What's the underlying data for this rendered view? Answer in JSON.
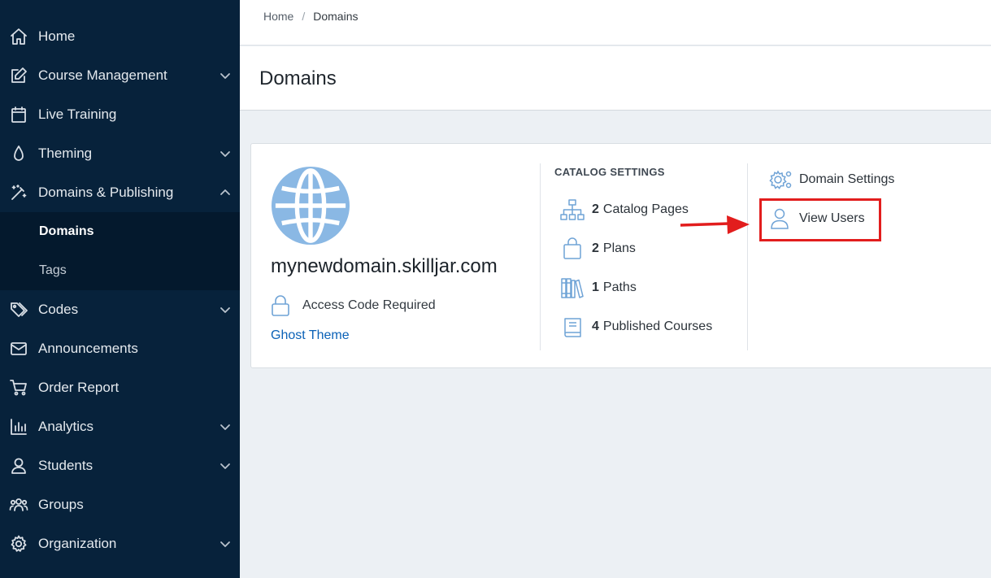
{
  "sidebar": {
    "items": [
      {
        "label": "Home",
        "icon": "home-icon",
        "chevron": false
      },
      {
        "label": "Course Management",
        "icon": "edit-icon",
        "chevron": "down"
      },
      {
        "label": "Live Training",
        "icon": "calendar-icon",
        "chevron": false
      },
      {
        "label": "Theming",
        "icon": "droplet-icon",
        "chevron": "down"
      },
      {
        "label": "Domains & Publishing",
        "icon": "magic-wand-icon",
        "chevron": "up"
      },
      {
        "label": "Codes",
        "icon": "tags-icon",
        "chevron": "down"
      },
      {
        "label": "Announcements",
        "icon": "envelope-icon",
        "chevron": false
      },
      {
        "label": "Order Report",
        "icon": "cart-icon",
        "chevron": false
      },
      {
        "label": "Analytics",
        "icon": "bar-chart-icon",
        "chevron": "down"
      },
      {
        "label": "Students",
        "icon": "user-icon",
        "chevron": "down"
      },
      {
        "label": "Groups",
        "icon": "users-icon",
        "chevron": false
      },
      {
        "label": "Organization",
        "icon": "gear-icon",
        "chevron": "down"
      }
    ],
    "submenu": [
      {
        "label": "Domains",
        "active": true
      },
      {
        "label": "Tags",
        "active": false
      }
    ]
  },
  "breadcrumb": {
    "home": "Home",
    "separator": "/",
    "current": "Domains"
  },
  "page": {
    "title": "Domains"
  },
  "domain": {
    "name": "mynewdomain.skilljar.com",
    "access": "Access Code Required",
    "theme": "Ghost Theme",
    "icon": "globe-icon"
  },
  "catalog": {
    "heading": "CATALOG SETTINGS",
    "items": [
      {
        "count": "2",
        "label": "Catalog Pages",
        "icon": "sitemap-icon"
      },
      {
        "count": "2",
        "label": "Plans",
        "icon": "shopping-bag-icon"
      },
      {
        "count": "1",
        "label": "Paths",
        "icon": "books-icon"
      },
      {
        "count": "4",
        "label": "Published Courses",
        "icon": "book-icon"
      }
    ]
  },
  "actions": {
    "domain_settings": "Domain Settings",
    "view_users": "View Users"
  },
  "colors": {
    "sidebar_bg": "#07223b",
    "accent": "#6fa3d6",
    "link": "#0b62b7",
    "highlight": "#e21d1d"
  }
}
